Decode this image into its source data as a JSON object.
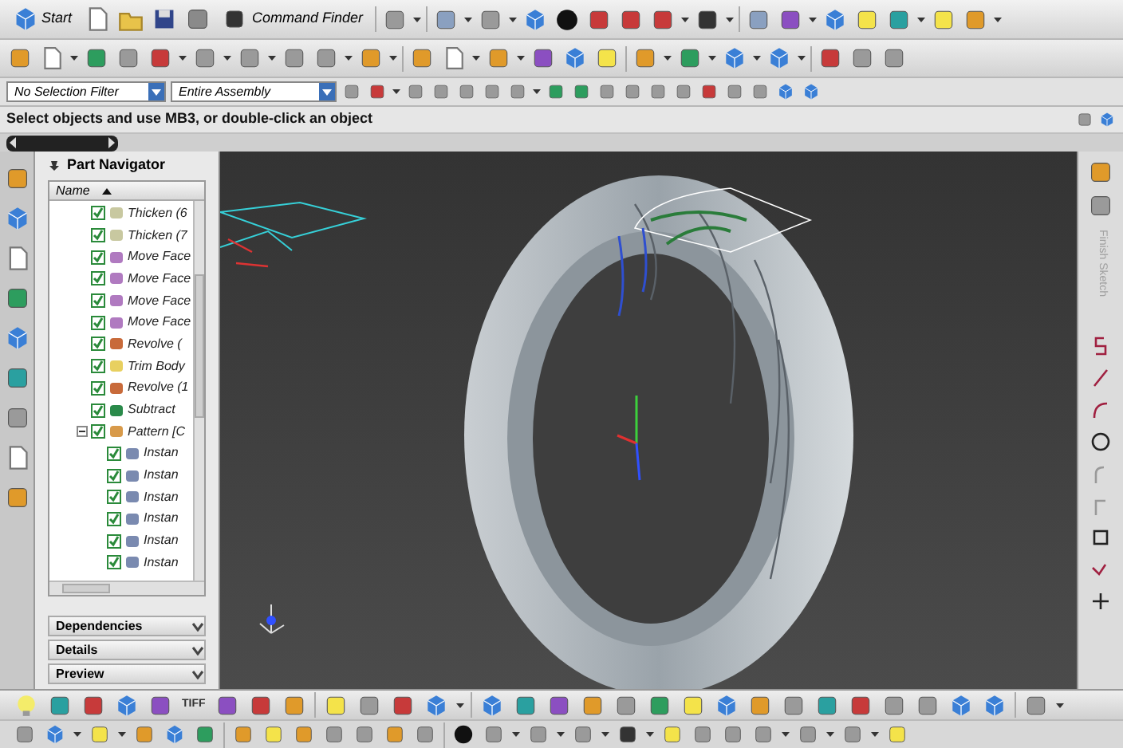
{
  "toolbar": {
    "start": "Start",
    "command_finder": "Command Finder"
  },
  "selection_bar": {
    "filter": "No Selection Filter",
    "scope": "Entire Assembly"
  },
  "status": "Select objects and use MB3, or double-click an object",
  "navigator": {
    "title": "Part Navigator",
    "column": "Name",
    "items": [
      {
        "label": "Thicken (6",
        "checked": true,
        "kind": "thicken"
      },
      {
        "label": "Thicken (7",
        "checked": true,
        "kind": "thicken"
      },
      {
        "label": "Move Face",
        "checked": true,
        "kind": "move"
      },
      {
        "label": "Move Face",
        "checked": true,
        "kind": "move"
      },
      {
        "label": "Move Face",
        "checked": true,
        "kind": "move"
      },
      {
        "label": "Move Face",
        "checked": true,
        "kind": "move"
      },
      {
        "label": "Revolve (",
        "checked": true,
        "kind": "revolve"
      },
      {
        "label": "Trim Body",
        "checked": true,
        "kind": "trim"
      },
      {
        "label": "Revolve (1",
        "checked": true,
        "kind": "revolve"
      },
      {
        "label": "Subtract",
        "checked": true,
        "kind": "subtract"
      },
      {
        "label": "Pattern [C",
        "checked": true,
        "kind": "pattern",
        "expanded": true,
        "children": [
          {
            "label": "Instan",
            "checked": true,
            "kind": "instance"
          },
          {
            "label": "Instan",
            "checked": true,
            "kind": "instance"
          },
          {
            "label": "Instan",
            "checked": true,
            "kind": "instance"
          },
          {
            "label": "Instan",
            "checked": true,
            "kind": "instance"
          },
          {
            "label": "Instan",
            "checked": true,
            "kind": "instance"
          },
          {
            "label": "Instan",
            "checked": true,
            "kind": "instance"
          }
        ]
      }
    ]
  },
  "panels": [
    {
      "label": "Dependencies",
      "expanded": false
    },
    {
      "label": "Details",
      "expanded": false
    },
    {
      "label": "Preview",
      "expanded": false
    }
  ],
  "sketch_palette": {
    "title": "Finish Sketch"
  },
  "bottom_toolbar": {
    "tiff_label": "TIFF"
  }
}
